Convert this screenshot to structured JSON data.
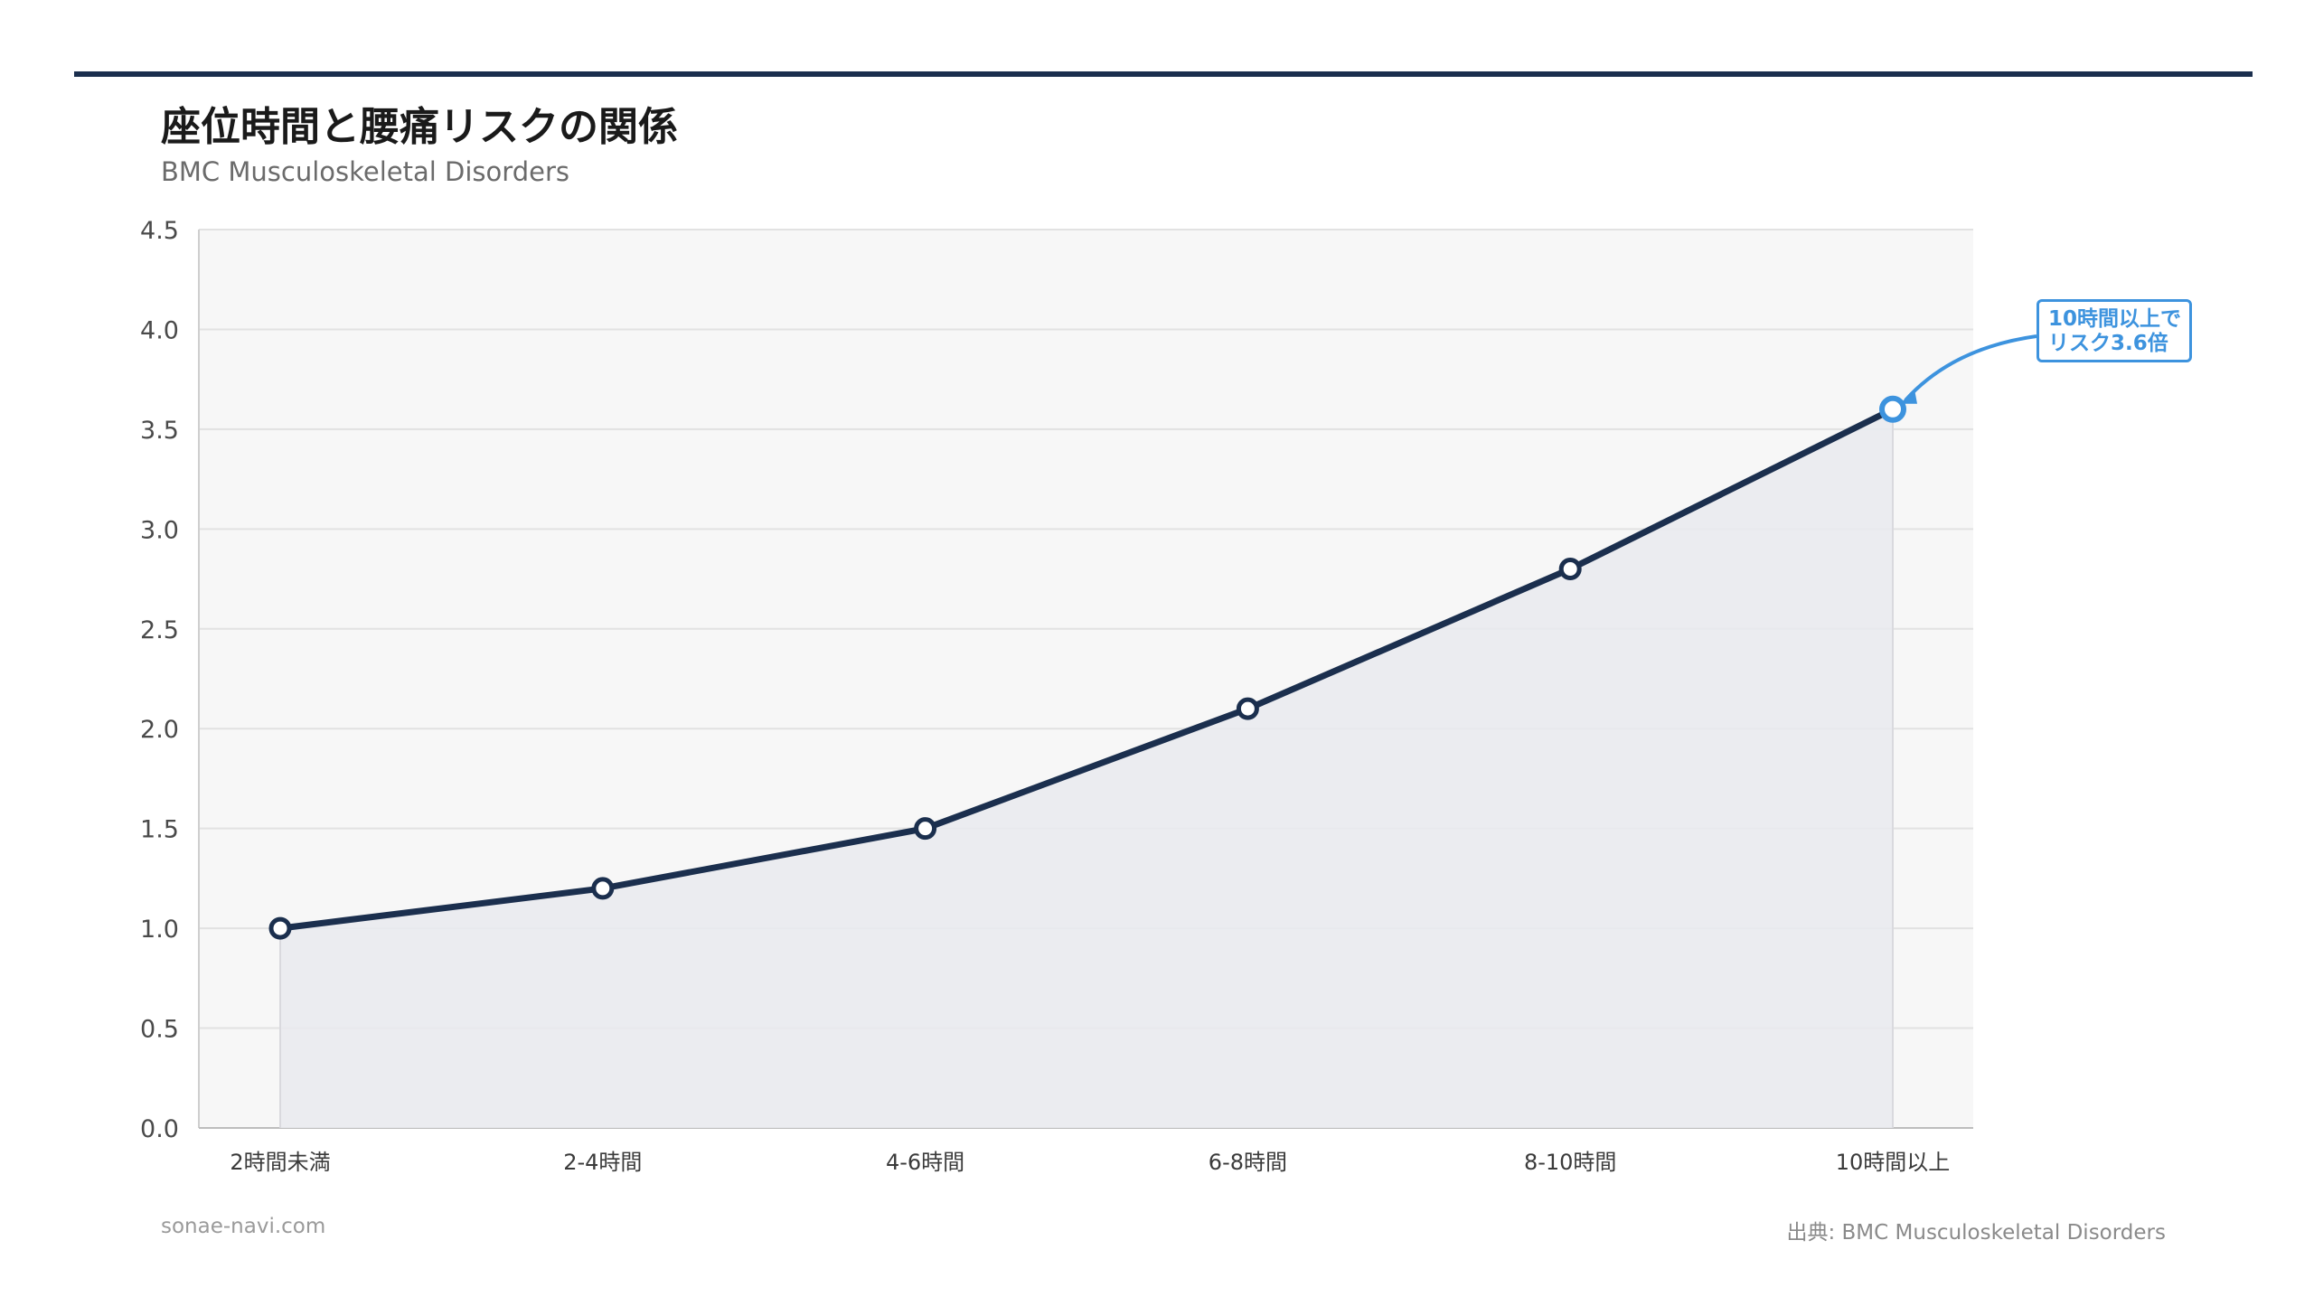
{
  "title": "座位時間と腰痛リスクの関係",
  "subtitle": "BMC Musculoskeletal Disorders",
  "footer": {
    "site": "sonae-navi.com",
    "source": "出典: BMC Musculoskeletal Disorders"
  },
  "colors": {
    "line": "#1b2f4e",
    "area": "#e9eaee",
    "plot_background": "#f7f7f7",
    "grid": "#e2e2e2",
    "highlight": "#3d93de"
  },
  "chart_data": {
    "type": "line",
    "categories": [
      "2時間未満",
      "2-4時間",
      "4-6時間",
      "6-8時間",
      "8-10時間",
      "10時間以上"
    ],
    "series": [
      {
        "values": [
          1.0,
          1.2,
          1.5,
          2.1,
          2.8,
          3.6
        ]
      }
    ],
    "ylim": [
      0,
      4.5
    ],
    "yticks": [
      "0.0",
      "0.5",
      "1.0",
      "1.5",
      "2.0",
      "2.5",
      "3.0",
      "3.5",
      "4.0",
      "4.5"
    ],
    "grid": true,
    "area_fill": true,
    "annotation": {
      "category": "10時間以上",
      "value": 3.6,
      "lines": [
        "10時間以上で",
        "リスク3.6倍"
      ]
    }
  }
}
